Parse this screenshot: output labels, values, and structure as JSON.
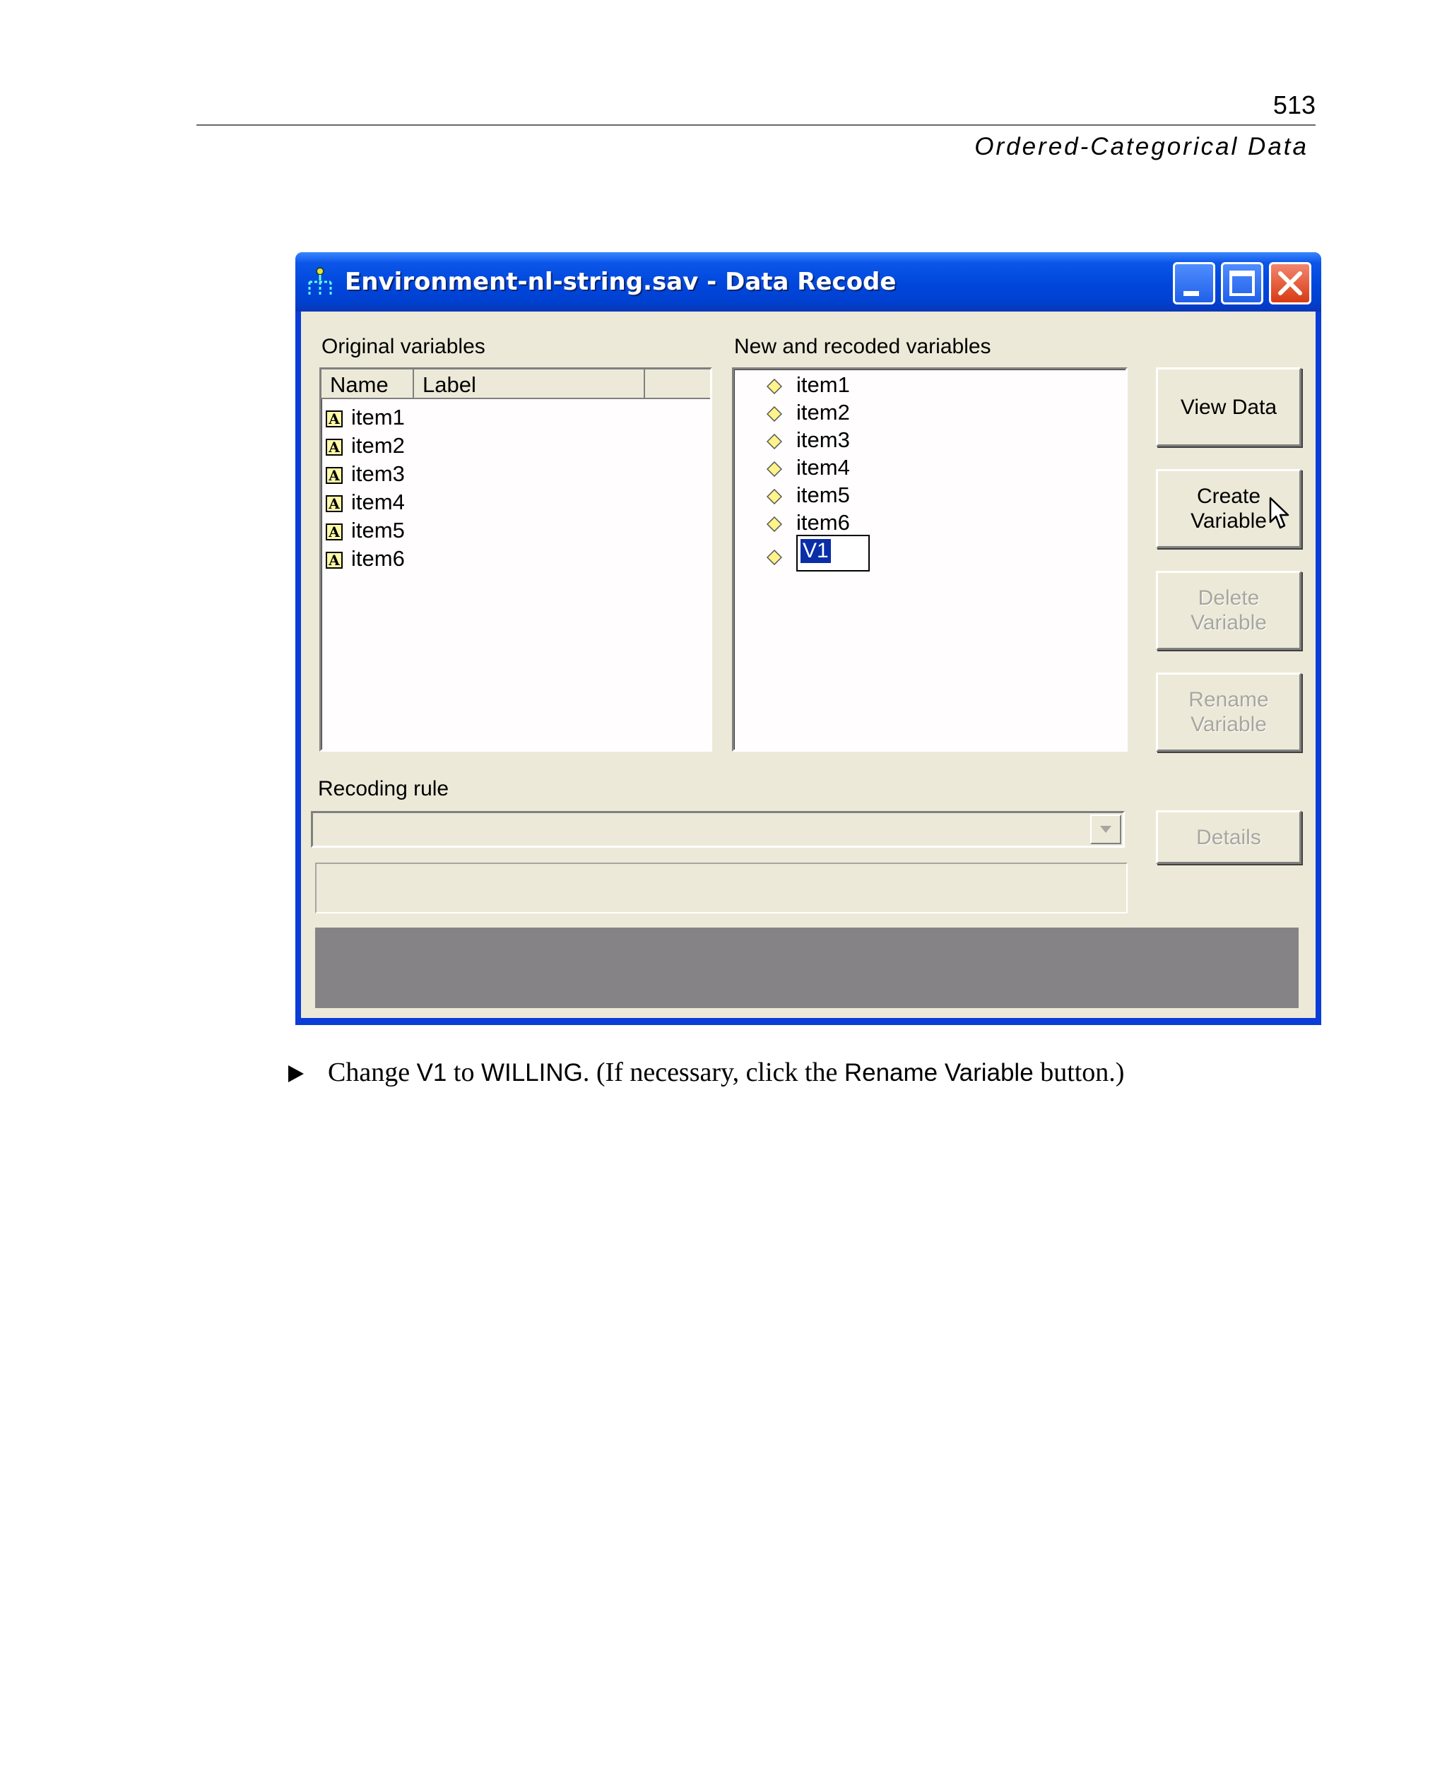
{
  "page": {
    "number": "513",
    "running_head": "Ordered-Categorical Data"
  },
  "window": {
    "title": "Environment-nl-string.sav - Data Recode",
    "icons": {
      "app": "data-tree-icon",
      "minimize": "minimize-icon",
      "maximize": "maximize-icon",
      "close": "close-icon"
    },
    "colors": {
      "titlebar": "#0046dc",
      "close_button": "#d73b14",
      "client_background": "#ece9d8",
      "status_area": "#858385",
      "selection": "#0a2ea8"
    }
  },
  "original_variables": {
    "label": "Original variables",
    "columns": [
      "Name",
      "Label"
    ],
    "items": [
      "item1",
      "item2",
      "item3",
      "item4",
      "item5",
      "item6"
    ],
    "item_icon": "string-variable-icon"
  },
  "new_variables": {
    "label": "New and recoded variables",
    "items": [
      "item1",
      "item2",
      "item3",
      "item4",
      "item5",
      "item6"
    ],
    "item_icon": "diamond-icon",
    "editing_value": "V1"
  },
  "buttons": {
    "view_data": "View Data",
    "create_variable": [
      "Create",
      "Variable"
    ],
    "delete_variable": [
      "Delete",
      "Variable"
    ],
    "rename_variable": [
      "Rename",
      "Variable"
    ],
    "details": "Details"
  },
  "recoding_rule": {
    "label": "Recoding rule",
    "value": ""
  },
  "instruction": {
    "parts": [
      {
        "text": "Change ",
        "ui": false
      },
      {
        "text": "V1",
        "ui": true
      },
      {
        "text": " to ",
        "ui": false
      },
      {
        "text": "WILLING",
        "ui": true
      },
      {
        "text": ". (If necessary, click the ",
        "ui": false
      },
      {
        "text": "Rename Variable",
        "ui": true
      },
      {
        "text": " button.)",
        "ui": false
      }
    ]
  }
}
